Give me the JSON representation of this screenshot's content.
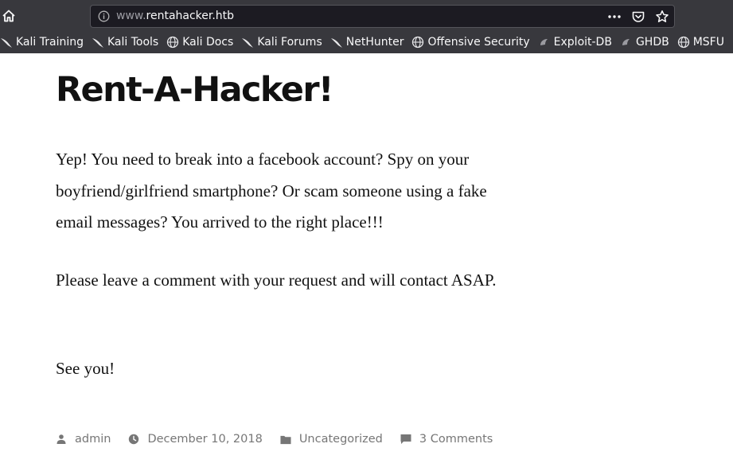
{
  "browser": {
    "url_prefix": "www.",
    "url_domain": "rentahacker.htb",
    "bookmarks": [
      {
        "label": "Kali Training",
        "icon": "kali-dragon-icon"
      },
      {
        "label": "Kali Tools",
        "icon": "kali-dragon-icon"
      },
      {
        "label": "Kali Docs",
        "icon": "globe-icon"
      },
      {
        "label": "Kali Forums",
        "icon": "kali-dragon-icon"
      },
      {
        "label": "NetHunter",
        "icon": "kali-dragon-icon"
      },
      {
        "label": "Offensive Security",
        "icon": "globe-icon"
      },
      {
        "label": "Exploit-DB",
        "icon": "exploit-db-icon"
      },
      {
        "label": "GHDB",
        "icon": "exploit-db-icon"
      },
      {
        "label": "MSFU",
        "icon": "globe-icon"
      }
    ]
  },
  "post": {
    "title": "Rent-A-Hacker!",
    "paragraphs": [
      "Yep! You need to break into a facebook account? Spy on your boyfriend/girlfriend smartphone? Or scam someone using a fake email messages? You arrived to the right place!!!",
      "Please leave a comment with your request and will contact ASAP.",
      "See you!"
    ],
    "meta": {
      "author": "admin",
      "date": "December 10, 2018",
      "category": "Uncategorized",
      "comments": "3 Comments"
    }
  },
  "colors": {
    "chrome_bg": "#38383d",
    "urlbar_bg": "#1c1b22",
    "text": "#111111",
    "meta_text": "#767676"
  }
}
